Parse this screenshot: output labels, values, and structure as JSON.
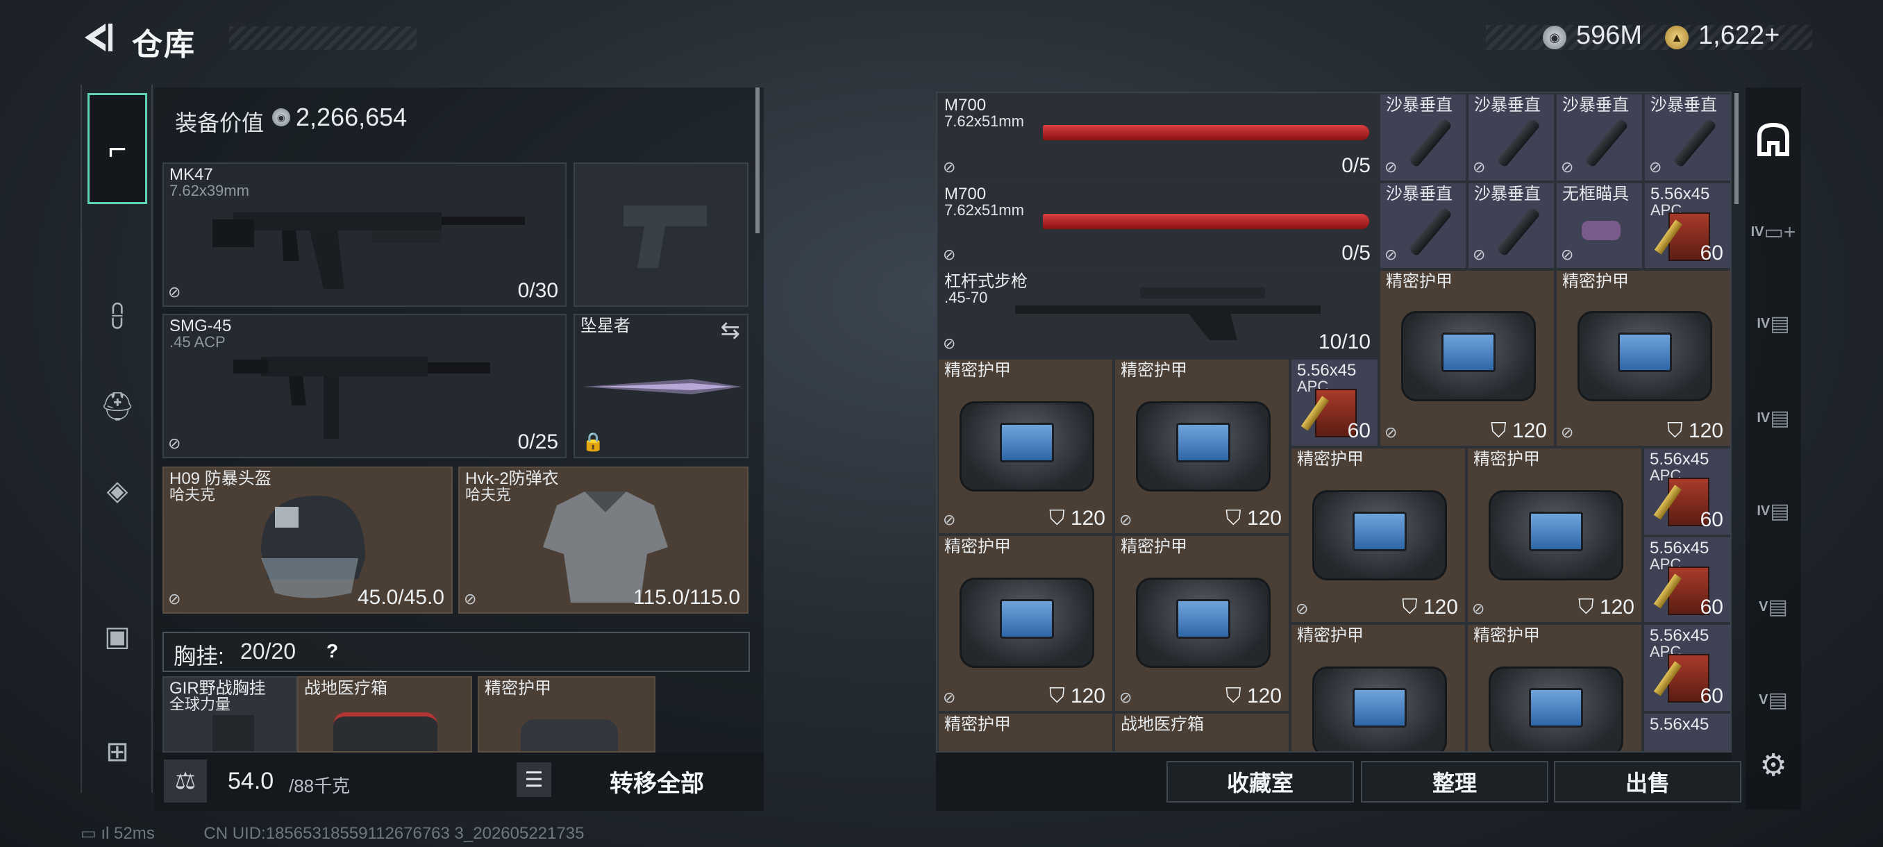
{
  "header": {
    "title": "仓库",
    "currency1": "596M",
    "currency2": "1,622+",
    "currency1_icon": "silver-coin-icon",
    "currency2_icon": "gold-coin-icon"
  },
  "left_nav": [
    {
      "name": "nav-guns",
      "icon": "pistol-icon",
      "glyph": "╤"
    },
    {
      "name": "nav-armor",
      "icon": "vest-icon",
      "glyph": "⩉"
    },
    {
      "name": "nav-backpack",
      "icon": "backpack-icon",
      "glyph": "⛑"
    },
    {
      "name": "nav-pouch",
      "icon": "pouch-icon",
      "glyph": "◈"
    },
    {
      "name": "nav-case",
      "icon": "case-icon",
      "glyph": "▣"
    },
    {
      "name": "nav-toolbox",
      "icon": "toolbox-icon",
      "glyph": "⊞"
    }
  ],
  "loadout": {
    "equip_value_label": "装备价值",
    "equip_value": "2,266,654",
    "primary": {
      "name": "MK47",
      "caliber": "7.62x39mm",
      "ammo": "0/30"
    },
    "secondary": {
      "name": "SMG-45",
      "caliber": ".45 ACP",
      "ammo": "0/25"
    },
    "melee": {
      "name": "坠星者"
    },
    "helmet": {
      "name": "H09 防暴头盔",
      "brand": "哈夫克",
      "durability": "45.0/45.0"
    },
    "armor": {
      "name": "Hvk-2防弹衣",
      "brand": "哈夫克",
      "durability": "115.0/115.0"
    },
    "chest_label": "胸挂:",
    "chest_value": "20/20",
    "chest_help": "?",
    "chest_items": [
      {
        "name": "GIR野战胸挂",
        "sub": "全球力量"
      },
      {
        "name": "战地医疗箱",
        "sub": ""
      },
      {
        "name": "精密护甲",
        "sub": ""
      }
    ],
    "weight": "54.0",
    "weight_cap": "/88千克",
    "transfer_all": "转移全部"
  },
  "stash": {
    "m700_name": "M700",
    "m700_caliber": "7.62x51mm",
    "m700_ammo": "0/5",
    "lever_name": "杠杆式步枪",
    "lever_caliber": ".45-70",
    "lever_ammo": "10/10",
    "suppressor": "沙暴垂直",
    "scope": "无框瞄具",
    "ammo_name": "5.56x45",
    "ammo_sub": "APC",
    "ammo_qty": "60",
    "armor_name": "精密护甲",
    "armor_val": "120",
    "medkit": "战地医疗箱",
    "buttons": {
      "collection": "收藏室",
      "organize": "整理",
      "sell": "出售"
    }
  },
  "right_nav": [
    {
      "name": "nav-home",
      "tier": "",
      "icon": "home-icon"
    },
    {
      "name": "nav-tier-iv-1",
      "tier": "IV",
      "icon": "case-icon"
    },
    {
      "name": "nav-tier-iv-2",
      "tier": "IV",
      "icon": "case-icon"
    },
    {
      "name": "nav-tier-iv-3",
      "tier": "IV",
      "icon": "case-icon"
    },
    {
      "name": "nav-tier-iv-4",
      "tier": "IV",
      "icon": "case-icon"
    },
    {
      "name": "nav-tier-v-1",
      "tier": "V",
      "icon": "case-icon"
    },
    {
      "name": "nav-tier-v-2",
      "tier": "V",
      "icon": "case-icon"
    }
  ],
  "status": {
    "ping": "52ms",
    "uid": "CN UID:18565318559112676763 3_202605221735"
  }
}
